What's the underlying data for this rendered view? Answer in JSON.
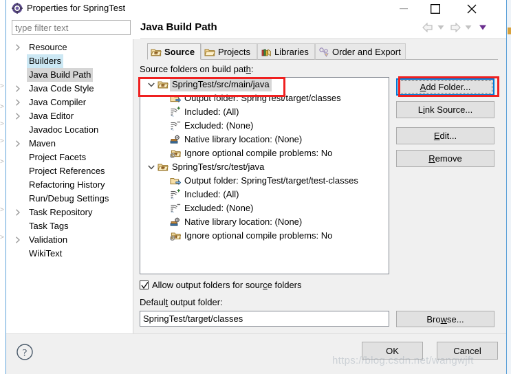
{
  "window": {
    "title": "Properties for SpringTest",
    "icon": "eclipse-properties-gear-icon",
    "minimize_label": "Minimize",
    "maximize_label": "Maximize",
    "close_label": "Close"
  },
  "search": {
    "placeholder": "type filter text",
    "value": ""
  },
  "header": {
    "page_title": "Java Build Path",
    "nav_back": "Back",
    "nav_back_menu": "Back history",
    "nav_forward": "Forward",
    "nav_forward_menu": "Forward history",
    "nav_menu": "View menu"
  },
  "sidebar": {
    "items": [
      {
        "label": "Resource",
        "expandable": true,
        "state": "normal"
      },
      {
        "label": "Builders",
        "expandable": false,
        "state": "hover"
      },
      {
        "label": "Java Build Path",
        "expandable": false,
        "state": "selected"
      },
      {
        "label": "Java Code Style",
        "expandable": true,
        "state": "normal"
      },
      {
        "label": "Java Compiler",
        "expandable": true,
        "state": "normal"
      },
      {
        "label": "Java Editor",
        "expandable": true,
        "state": "normal"
      },
      {
        "label": "Javadoc Location",
        "expandable": false,
        "state": "normal"
      },
      {
        "label": "Maven",
        "expandable": true,
        "state": "normal"
      },
      {
        "label": "Project Facets",
        "expandable": false,
        "state": "normal"
      },
      {
        "label": "Project References",
        "expandable": false,
        "state": "normal"
      },
      {
        "label": "Refactoring History",
        "expandable": false,
        "state": "normal"
      },
      {
        "label": "Run/Debug Settings",
        "expandable": false,
        "state": "normal"
      },
      {
        "label": "Task Repository",
        "expandable": true,
        "state": "normal"
      },
      {
        "label": "Task Tags",
        "expandable": false,
        "state": "normal"
      },
      {
        "label": "Validation",
        "expandable": true,
        "state": "normal"
      },
      {
        "label": "WikiText",
        "expandable": false,
        "state": "normal"
      }
    ]
  },
  "tabs": [
    {
      "label": "Source",
      "icon": "source-folder-icon",
      "active": true
    },
    {
      "label": "Projects",
      "icon": "open-folder-icon",
      "active": false
    },
    {
      "label": "Libraries",
      "icon": "books-icon",
      "active": false
    },
    {
      "label": "Order and Export",
      "icon": "order-export-icon",
      "active": false
    }
  ],
  "main": {
    "section_label_pre": "Source folders on build pat",
    "section_label_accel": "h",
    "section_label_post": ":",
    "source_tree": [
      {
        "label": "SpringTest/src/main/java",
        "icon": "source-folder-icon",
        "selected": true,
        "expanded": true,
        "children": [
          {
            "label": "Output folder: SpringTest/target/classes",
            "icon": "output-folder-icon"
          },
          {
            "label": "Included: (All)",
            "icon": "included-filter-icon"
          },
          {
            "label": "Excluded: (None)",
            "icon": "excluded-filter-icon"
          },
          {
            "label": "Native library location: (None)",
            "icon": "native-library-icon"
          },
          {
            "label": "Ignore optional compile problems: No",
            "icon": "ignore-problems-icon"
          }
        ]
      },
      {
        "label": "SpringTest/src/test/java",
        "icon": "source-folder-icon",
        "selected": false,
        "expanded": true,
        "children": [
          {
            "label": "Output folder: SpringTest/target/test-classes",
            "icon": "output-folder-icon"
          },
          {
            "label": "Included: (All)",
            "icon": "included-filter-icon"
          },
          {
            "label": "Excluded: (None)",
            "icon": "excluded-filter-icon"
          },
          {
            "label": "Native library location: (None)",
            "icon": "native-library-icon"
          },
          {
            "label": "Ignore optional compile problems: No",
            "icon": "ignore-problems-icon"
          }
        ]
      }
    ],
    "side_buttons": {
      "add_folder": {
        "pre": "",
        "accel": "A",
        "post": "dd Folder...",
        "focused": true
      },
      "link_source": {
        "pre": "L",
        "accel": "i",
        "post": "nk Source..."
      },
      "edit": {
        "pre": "",
        "accel": "E",
        "post": "dit..."
      },
      "remove": {
        "pre": "",
        "accel": "R",
        "post": "emove"
      }
    },
    "allow_output_checkbox": {
      "pre": "Allow output folders for sour",
      "accel": "c",
      "post": "e folders",
      "checked": true
    },
    "default_output_label_pre": "Defaul",
    "default_output_label_accel": "t",
    "default_output_label_post": " output folder:",
    "default_output_value": "SpringTest/target/classes",
    "browse_button": {
      "pre": "Bro",
      "accel": "w",
      "post": "se..."
    }
  },
  "footer": {
    "help": "help-icon",
    "ok_label": "OK",
    "cancel_label": "Cancel"
  },
  "annotations": [
    {
      "name": "highlight-source-folder-row",
      "color": "#ef2020"
    },
    {
      "name": "highlight-add-folder-button",
      "color": "#ef2020"
    }
  ],
  "watermark": "https://blog.csdn.net/wangwjft"
}
